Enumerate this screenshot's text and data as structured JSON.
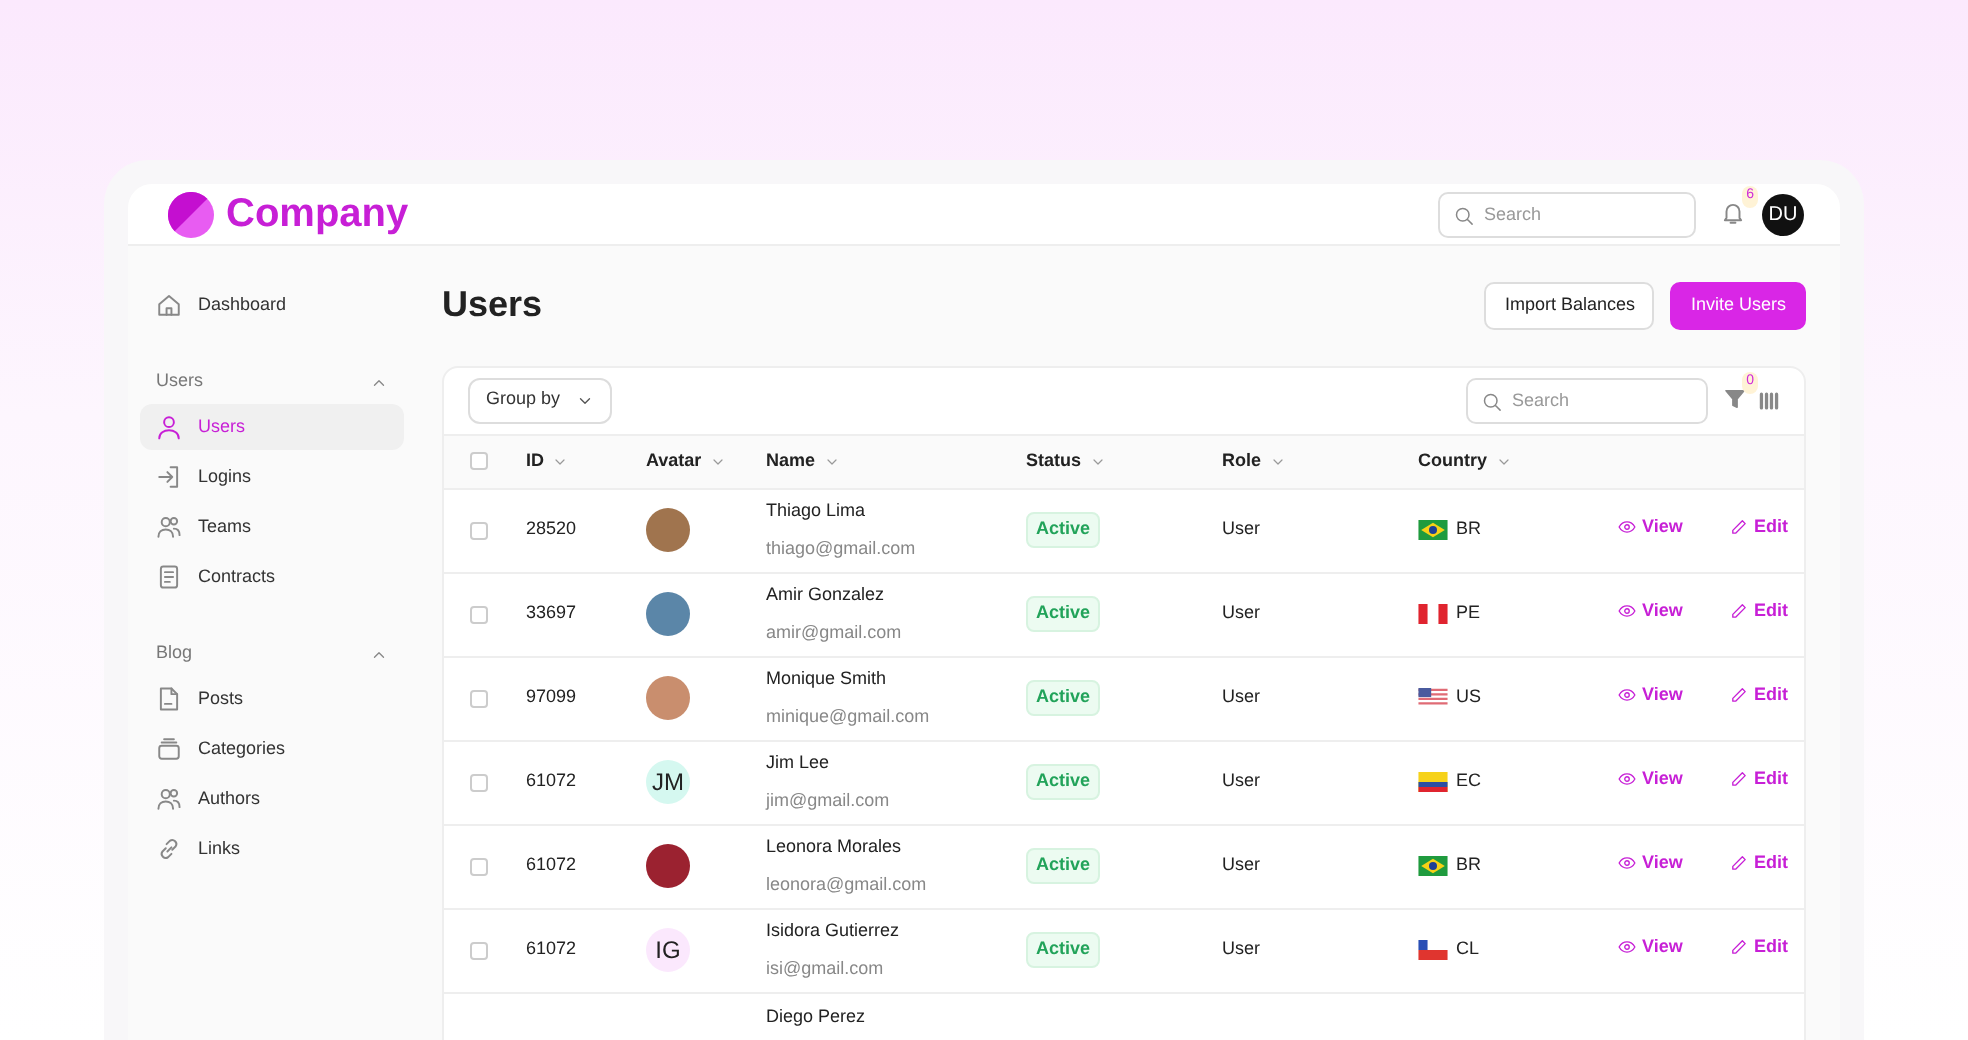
{
  "header": {
    "logo_text": "Company",
    "search": {
      "placeholder": "Search"
    },
    "notifications": "6",
    "user_initials": "DU"
  },
  "sidebar": {
    "items": [
      {
        "label": "Dashboard",
        "selected": false
      }
    ],
    "groups": [
      {
        "title": "Users",
        "expanded": true,
        "items": [
          {
            "label": "Users",
            "selected": true
          },
          {
            "label": "Logins",
            "selected": false
          },
          {
            "label": "Teams",
            "selected": false
          },
          {
            "label": "Contracts",
            "selected": false
          }
        ]
      },
      {
        "title": "Blog",
        "expanded": true,
        "items": [
          {
            "label": "Posts",
            "selected": false
          },
          {
            "label": "Categories",
            "selected": false
          },
          {
            "label": "Authors",
            "selected": false
          },
          {
            "label": "Links",
            "selected": false
          }
        ]
      }
    ]
  },
  "page": {
    "title": "Users",
    "buttons": [
      {
        "label": "Import Balances",
        "kind": "secondary"
      },
      {
        "label": "Invite Users",
        "kind": "primary"
      }
    ]
  },
  "table": {
    "group_by": "Group by",
    "search": {
      "placeholder": "Search"
    },
    "filter_count": "0",
    "all_checked": false,
    "columns": [
      "ID",
      "Avatar",
      "Name",
      "Status",
      "Role",
      "Country"
    ],
    "rows": [
      {
        "id": "28520",
        "avatar": {
          "kind": "photo",
          "color": "#a0744e"
        },
        "name": "Thiago Lima",
        "email": "thiago@gmail.com",
        "status": "Active",
        "role": "User",
        "country": "BR",
        "actions": [
          "View",
          "Edit"
        ],
        "checked": false
      },
      {
        "id": "33697",
        "avatar": {
          "kind": "photo",
          "color": "#5b86a8"
        },
        "name": "Amir Gonzalez",
        "email": "amir@gmail.com",
        "status": "Active",
        "role": "User",
        "country": "PE",
        "actions": [
          "View",
          "Edit"
        ],
        "checked": false
      },
      {
        "id": "97099",
        "avatar": {
          "kind": "photo",
          "color": "#c98e6e"
        },
        "name": "Monique Smith",
        "email": "minique@gmail.com",
        "status": "Active",
        "role": "User",
        "country": "US",
        "actions": [
          "View",
          "Edit"
        ],
        "checked": false
      },
      {
        "id": "61072",
        "avatar": {
          "kind": "initials",
          "text": "JM",
          "color": "#d5f8f0"
        },
        "name": "Jim Lee",
        "email": "jim@gmail.com",
        "status": "Active",
        "role": "User",
        "country": "EC",
        "actions": [
          "View",
          "Edit"
        ],
        "checked": false
      },
      {
        "id": "61072",
        "avatar": {
          "kind": "photo",
          "color": "#9b2230"
        },
        "name": "Leonora Morales",
        "email": "leonora@gmail.com",
        "status": "Active",
        "role": "User",
        "country": "BR",
        "actions": [
          "View",
          "Edit"
        ],
        "checked": false
      },
      {
        "id": "61072",
        "avatar": {
          "kind": "initials",
          "text": "IG",
          "color": "#fbe8fd"
        },
        "name": "Isidora Gutierrez",
        "email": "isi@gmail.com",
        "status": "Active",
        "role": "User",
        "country": "CL",
        "actions": [
          "View",
          "Edit"
        ],
        "checked": false
      },
      {
        "name": "Diego Perez"
      }
    ]
  }
}
